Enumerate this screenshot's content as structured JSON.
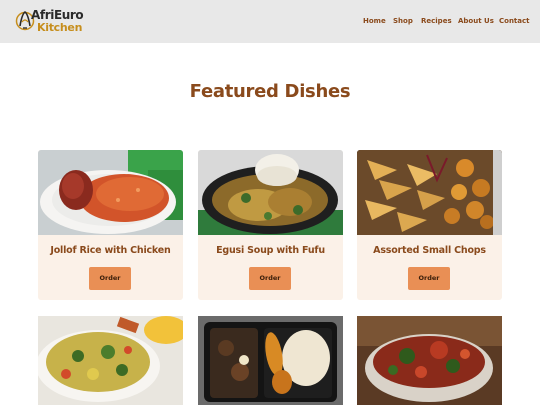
{
  "brand": {
    "name_line1": "AfriEuro",
    "name_line2": "Kitchen",
    "accent_gold": "#c68e1d",
    "accent_brown": "#8a4a1c"
  },
  "nav": {
    "items": [
      {
        "label": "Home"
      },
      {
        "label": "Shop"
      },
      {
        "label": "Recipes"
      },
      {
        "label": "About Us"
      },
      {
        "label": "Contact"
      }
    ]
  },
  "featured": {
    "title": "Featured Dishes",
    "dishes": [
      {
        "name": "Jollof Rice with Chicken",
        "button": "Order"
      },
      {
        "name": "Egusi Soup with Fufu",
        "button": "Order"
      },
      {
        "name": "Assorted Small Chops",
        "button": "Order"
      }
    ],
    "more_dish_images": [
      "vegetable-rice-dish",
      "rice-and-plantain-takeaway",
      "vegetable-stew-bowl"
    ]
  },
  "colors": {
    "button": "#e98f55",
    "card_bg": "#fbf1e8",
    "header_bg": "#e8e8e8"
  }
}
